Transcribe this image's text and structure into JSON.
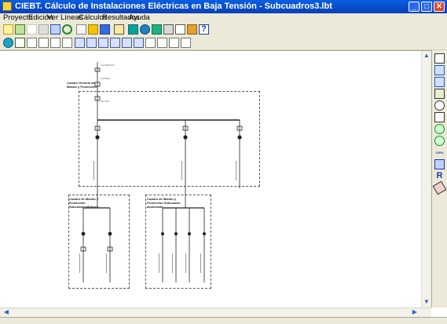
{
  "window": {
    "title": "CIEBT. Cálculo de Instalaciones Eléctricas en Baja Tensión - Subcuadros3.lbt",
    "minimize_glyph": "_",
    "maximize_glyph": "□",
    "close_glyph": "✕"
  },
  "menu": {
    "items": [
      "Proyecto",
      "Edición",
      "Ver",
      "Líneas",
      "Cálculos",
      "Resultados",
      "Ayuda"
    ]
  },
  "toolbar1": {
    "icons": [
      "new-schema-icon",
      "open-icon",
      "cut-icon",
      "paste-icon",
      "copy-icon",
      "undo-icon",
      "redo-icon",
      "lightning-icon",
      "add-line-icon",
      "save-icon",
      "table-icon",
      "calc-icon",
      "photo-icon",
      "print-icon",
      "print-preview-icon",
      "export-icon",
      "help-icon"
    ],
    "help_glyph": "?"
  },
  "toolbar2": {
    "icons": [
      "motor-icon",
      "receptor-icon",
      "lamp-icon",
      "fuse-icon",
      "relay-icon",
      "switch-icon",
      "panel-icon",
      "bus-icon",
      "transformer-icon",
      "busbar-icon",
      "ground-icon",
      "meter-icon",
      "breaker-icon",
      "battery-icon",
      "capacitor-icon",
      "subpanel-icon"
    ]
  },
  "rightbar": {
    "icons": [
      "pointer-icon",
      "zoom-width-icon",
      "zoom-height-icon",
      "grid-icon",
      "zoom-icon",
      "pan-hand-icon",
      "zoom-in-icon",
      "zoom-out-icon",
      "zoom-100-icon",
      "zoom-fit-icon",
      "redraw-icon",
      "eraser-icon"
    ],
    "zoom100_label": "100%",
    "redraw_glyph": "R"
  },
  "diagram": {
    "main_panel_label": "Cuadro General de Mando y Protección",
    "sub1_label": "Cuadro de Mando y Protección Subcuadro Motores",
    "sub2_label": "Cuadro de Mando y Protección Subcuadro alumbrado",
    "feed_label": "ACOMETIDA",
    "fuse_label": "FUSIBLE",
    "breaker_label": "IGA 40A"
  },
  "scroll": {
    "up_glyph": "▲",
    "down_glyph": "▼",
    "left_glyph": "◀",
    "right_glyph": "▶"
  },
  "colors": {
    "titlebar": "#0a5ee0",
    "chrome": "#ece9d8",
    "close": "#e0452a"
  }
}
